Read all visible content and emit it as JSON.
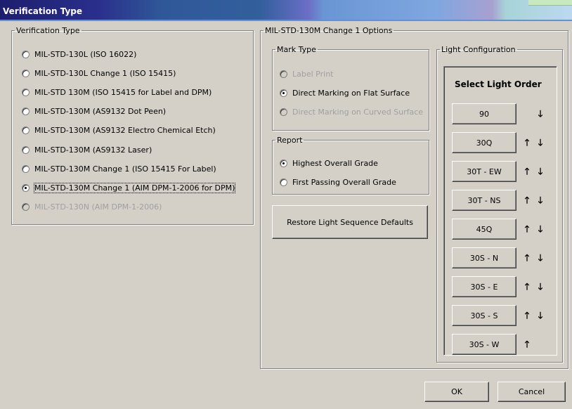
{
  "window": {
    "title": "Verification Type"
  },
  "verification_type": {
    "legend": "Verification Type",
    "options": [
      {
        "label": "MIL-STD-130L (ISO 16022)",
        "selected": false,
        "enabled": true
      },
      {
        "label": "MIL-STD-130L Change 1 (ISO 15415)",
        "selected": false,
        "enabled": true
      },
      {
        "label": "MIL-STD 130M (ISO 15415 for Label and DPM)",
        "selected": false,
        "enabled": true
      },
      {
        "label": "MIL-STD-130M (AS9132 Dot Peen)",
        "selected": false,
        "enabled": true
      },
      {
        "label": "MIL-STD-130M (AS9132 Electro Chemical Etch)",
        "selected": false,
        "enabled": true
      },
      {
        "label": "MIL-STD-130M (AS9132 Laser)",
        "selected": false,
        "enabled": true
      },
      {
        "label": "MIL-STD-130M Change 1 (ISO 15415 For Label)",
        "selected": false,
        "enabled": true
      },
      {
        "label": "MIL-STD-130M Change 1 (AIM DPM-1-2006 for DPM)",
        "selected": true,
        "enabled": true
      },
      {
        "label": "MIL-STD-130N (AIM DPM-1-2006)",
        "selected": false,
        "enabled": false
      }
    ]
  },
  "options_group": {
    "legend": "MIL-STD-130M Change 1 Options"
  },
  "mark_type": {
    "legend": "Mark Type",
    "options": [
      {
        "label": "Label Print",
        "selected": false,
        "enabled": false
      },
      {
        "label": "Direct Marking on Flat Surface",
        "selected": true,
        "enabled": true
      },
      {
        "label": "Direct Marking on Curved Surface",
        "selected": false,
        "enabled": false
      }
    ]
  },
  "report": {
    "legend": "Report",
    "options": [
      {
        "label": "Highest Overall Grade",
        "selected": true,
        "enabled": true
      },
      {
        "label": "First Passing Overall Grade",
        "selected": false,
        "enabled": true
      }
    ]
  },
  "restore_button": "Restore Light Sequence Defaults",
  "light_config": {
    "legend": "Light Configuration",
    "header": "Select Light Order",
    "lights": [
      {
        "label": "90",
        "up": false,
        "down": true
      },
      {
        "label": "30Q",
        "up": true,
        "down": true
      },
      {
        "label": "30T - EW",
        "up": true,
        "down": true
      },
      {
        "label": "30T - NS",
        "up": true,
        "down": true
      },
      {
        "label": "45Q",
        "up": true,
        "down": true
      },
      {
        "label": "30S - N",
        "up": true,
        "down": true
      },
      {
        "label": "30S - E",
        "up": true,
        "down": true
      },
      {
        "label": "30S - S",
        "up": true,
        "down": true
      },
      {
        "label": "30S - W",
        "up": true,
        "down": false
      }
    ],
    "up_glyph": "🡑",
    "down_glyph": "🡓"
  },
  "footer": {
    "ok": "OK",
    "cancel": "Cancel"
  }
}
